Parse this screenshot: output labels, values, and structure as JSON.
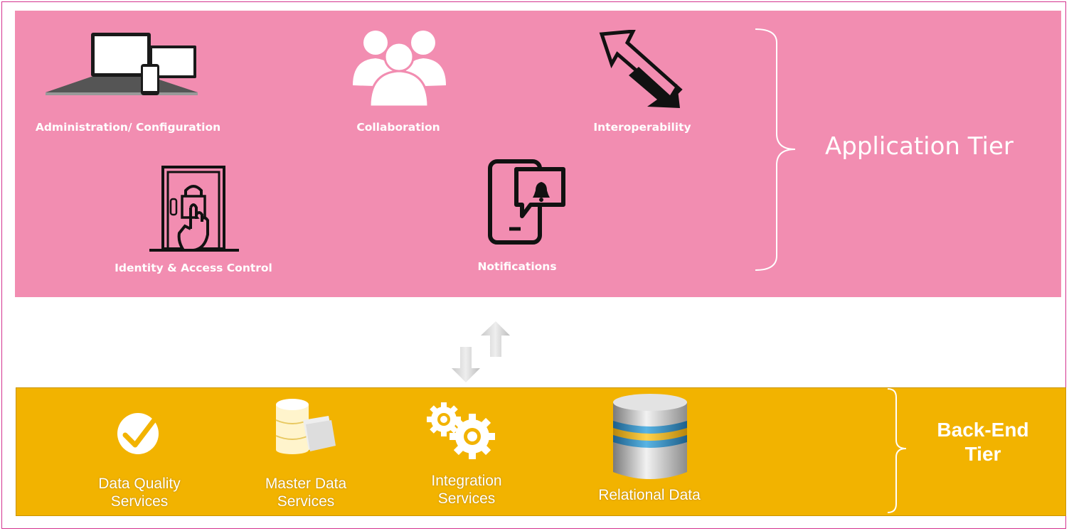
{
  "application_tier": {
    "title": "Application Tier",
    "components": [
      {
        "label": "Administration/ Configuration",
        "icon": "devices-icon"
      },
      {
        "label": "Collaboration",
        "icon": "people-icon"
      },
      {
        "label": "Interoperability",
        "icon": "bidirectional-arrow-icon"
      },
      {
        "label": "Identity & Access Control",
        "icon": "door-lock-icon"
      },
      {
        "label": "Notifications",
        "icon": "mobile-notification-icon"
      }
    ]
  },
  "backend_tier": {
    "title_line1": "Back-End",
    "title_line2": "Tier",
    "components": [
      {
        "label_line1": "Data Quality",
        "label_line2": "Services",
        "icon": "checkmark-icon"
      },
      {
        "label_line1": "Master Data",
        "label_line2": "Services",
        "icon": "database-documents-icon"
      },
      {
        "label_line1": "Integration",
        "label_line2": "Services",
        "icon": "gears-icon"
      },
      {
        "label_line1": "Relational Data",
        "label_line2": "",
        "icon": "database-cylinder-icon"
      }
    ]
  },
  "connector": {
    "icon": "up-down-arrows-icon"
  },
  "colors": {
    "application_tier": "#f28db1",
    "backend_tier": "#f2b300",
    "frame_border": "#d4338f"
  }
}
